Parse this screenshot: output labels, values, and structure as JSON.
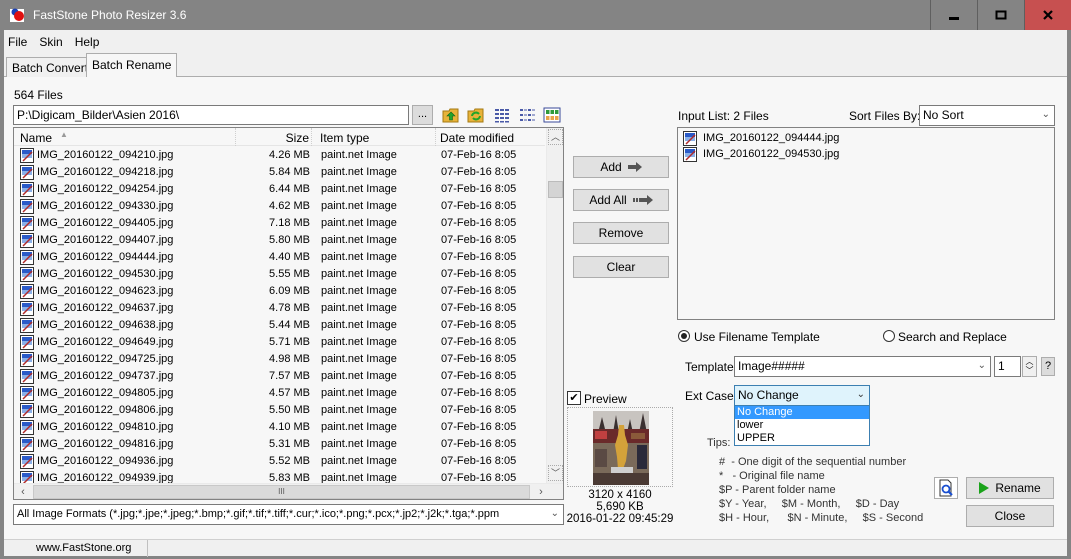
{
  "window": {
    "title": "FastStone Photo Resizer 3.6",
    "minimize_glyph": "▬",
    "maximize_glyph": "□",
    "close_glyph": "✕"
  },
  "menu": [
    "File",
    "Skin",
    "Help"
  ],
  "tabs": [
    {
      "label": "Batch Convert",
      "active": false
    },
    {
      "label": "Batch Rename",
      "active": true
    }
  ],
  "browser": {
    "files_count": "564 Files",
    "path": "P:\\Digicam_Bilder\\Asien 2016\\",
    "browse_label": "...",
    "toolbar_icons": [
      "folder-up-icon",
      "folder-refresh-icon",
      "details-view-icon",
      "list-view-icon",
      "thumbnail-view-icon"
    ],
    "columns": [
      "Name",
      "Size",
      "Item type",
      "Date modified"
    ],
    "rows": [
      {
        "name": "IMG_20160122_094210.jpg",
        "size": "4.26 MB",
        "type": "paint.net Image",
        "date": "07-Feb-16 8:05"
      },
      {
        "name": "IMG_20160122_094218.jpg",
        "size": "5.84 MB",
        "type": "paint.net Image",
        "date": "07-Feb-16 8:05"
      },
      {
        "name": "IMG_20160122_094254.jpg",
        "size": "6.44 MB",
        "type": "paint.net Image",
        "date": "07-Feb-16 8:05"
      },
      {
        "name": "IMG_20160122_094330.jpg",
        "size": "4.62 MB",
        "type": "paint.net Image",
        "date": "07-Feb-16 8:05"
      },
      {
        "name": "IMG_20160122_094405.jpg",
        "size": "7.18 MB",
        "type": "paint.net Image",
        "date": "07-Feb-16 8:05"
      },
      {
        "name": "IMG_20160122_094407.jpg",
        "size": "5.80 MB",
        "type": "paint.net Image",
        "date": "07-Feb-16 8:05"
      },
      {
        "name": "IMG_20160122_094444.jpg",
        "size": "4.40 MB",
        "type": "paint.net Image",
        "date": "07-Feb-16 8:05"
      },
      {
        "name": "IMG_20160122_094530.jpg",
        "size": "5.55 MB",
        "type": "paint.net Image",
        "date": "07-Feb-16 8:05"
      },
      {
        "name": "IMG_20160122_094623.jpg",
        "size": "6.09 MB",
        "type": "paint.net Image",
        "date": "07-Feb-16 8:05"
      },
      {
        "name": "IMG_20160122_094637.jpg",
        "size": "4.78 MB",
        "type": "paint.net Image",
        "date": "07-Feb-16 8:05"
      },
      {
        "name": "IMG_20160122_094638.jpg",
        "size": "5.44 MB",
        "type": "paint.net Image",
        "date": "07-Feb-16 8:05"
      },
      {
        "name": "IMG_20160122_094649.jpg",
        "size": "5.71 MB",
        "type": "paint.net Image",
        "date": "07-Feb-16 8:05"
      },
      {
        "name": "IMG_20160122_094725.jpg",
        "size": "4.98 MB",
        "type": "paint.net Image",
        "date": "07-Feb-16 8:05"
      },
      {
        "name": "IMG_20160122_094737.jpg",
        "size": "7.57 MB",
        "type": "paint.net Image",
        "date": "07-Feb-16 8:05"
      },
      {
        "name": "IMG_20160122_094805.jpg",
        "size": "4.57 MB",
        "type": "paint.net Image",
        "date": "07-Feb-16 8:05"
      },
      {
        "name": "IMG_20160122_094806.jpg",
        "size": "5.50 MB",
        "type": "paint.net Image",
        "date": "07-Feb-16 8:05"
      },
      {
        "name": "IMG_20160122_094810.jpg",
        "size": "4.10 MB",
        "type": "paint.net Image",
        "date": "07-Feb-16 8:05"
      },
      {
        "name": "IMG_20160122_094816.jpg",
        "size": "5.31 MB",
        "type": "paint.net Image",
        "date": "07-Feb-16 8:05"
      },
      {
        "name": "IMG_20160122_094936.jpg",
        "size": "5.52 MB",
        "type": "paint.net Image",
        "date": "07-Feb-16 8:05"
      },
      {
        "name": "IMG_20160122_094939.jpg",
        "size": "5.83 MB",
        "type": "paint.net Image",
        "date": "07-Feb-16 8:05"
      }
    ],
    "filter": "All Image Formats (*.jpg;*.jpe;*.jpeg;*.bmp;*.gif;*.tif;*.tiff;*.cur;*.ico;*.png;*.pcx;*.jp2;*.j2k;*.tga;*.ppm"
  },
  "actions": {
    "add": "Add",
    "add_all": "Add All",
    "remove": "Remove",
    "clear": "Clear"
  },
  "preview": {
    "checked": true,
    "label": "Preview",
    "dimensions": "3120 x 4160",
    "filesize": "5,690 KB",
    "datetime": "2016-01-22 09:45:29"
  },
  "input_list": {
    "label": "Input List:  2 Files",
    "sort_label": "Sort Files By:",
    "sort_value": "No Sort",
    "items": [
      "IMG_20160122_094444.jpg",
      "IMG_20160122_094530.jpg"
    ]
  },
  "rename": {
    "mode_template": "Use Filename Template",
    "mode_search": "Search and Replace",
    "selected_mode": "template",
    "template_label": "Template:",
    "template_value": "Image#####",
    "start_number": "1",
    "help_label": "?",
    "ext_label": "Ext Case:",
    "ext_value": "No Change",
    "ext_options": [
      "No Change",
      "lower",
      "UPPER"
    ],
    "ext_selected_index": 0,
    "tips_label": "Tips:",
    "tips": [
      "#  - One digit of the sequential number",
      "*   - Original file name",
      "$P - Parent folder name",
      "$Y - Year,     $M - Month,     $D - Day",
      "$H - Hour,      $N - Minute,     $S - Second"
    ],
    "rename_label": "Rename",
    "close_label": "Close"
  },
  "status": {
    "url": "www.FastStone.org"
  },
  "colors": {
    "titlebar": "#848484",
    "close_button": "#c75050",
    "selection": "#3399ff",
    "dropdown_focus": "#dff3fc"
  }
}
